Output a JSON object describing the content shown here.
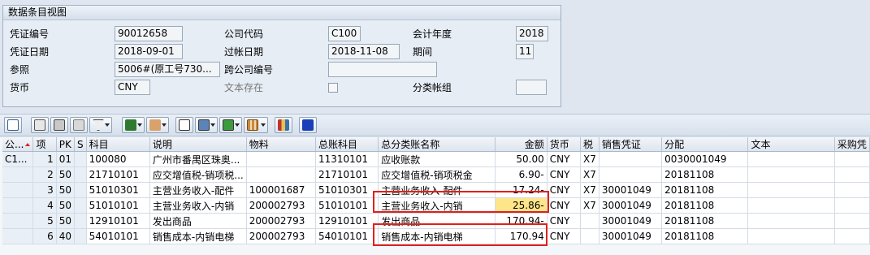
{
  "header": {
    "title": "数据条目视图",
    "doc_no_label": "凭证编号",
    "doc_no": "90012658",
    "company_label": "公司代码",
    "company": "C100",
    "fiscal_year_label": "会计年度",
    "fiscal_year": "2018",
    "doc_date_label": "凭证日期",
    "doc_date": "2018-09-01",
    "posting_date_label": "过帐日期",
    "posting_date": "2018-11-08",
    "period_label": "期间",
    "period": "11",
    "reference_label": "参照",
    "reference": "5006#(原工号730...",
    "cross_company_label": "跨公司编号",
    "cross_company": "",
    "currency_label": "货币",
    "currency": "CNY",
    "text_exists_label": "文本存在",
    "ledger_group_label": "分类帐组",
    "ledger_group": ""
  },
  "toolbar": {
    "buttons": [
      "details-icon",
      "print-icon",
      "filter-icon",
      "sort-icon",
      "filter-dropdown-icon",
      "sum-icon",
      "subtotal-icon",
      "print-preview-icon",
      "export-icon",
      "layout-icon",
      "grid-layout-icon",
      "abc-analysis-icon",
      "info-icon"
    ]
  },
  "table": {
    "columns": [
      "公...",
      "项",
      "PK",
      "S",
      "科目",
      "说明",
      "物料",
      "总账科目",
      "总分类账名称",
      "金额",
      "货币",
      "税",
      "销售凭证",
      "分配",
      "文本",
      "采购凭"
    ],
    "rows": [
      {
        "co": "C1...",
        "item": "1",
        "pk": "01",
        "s": "",
        "acct": "100080",
        "desc": "广州市番禺区珠奥...",
        "material": "",
        "gl": "11310101",
        "gl_name": "应收账款",
        "amount": "50.00",
        "curr": "CNY",
        "tax": "X7",
        "sales_doc": "",
        "assign": "0030001049",
        "text": "",
        "po": ""
      },
      {
        "co": "",
        "item": "2",
        "pk": "50",
        "s": "",
        "acct": "21710101",
        "desc": "应交增值税-销项税...",
        "material": "",
        "gl": "21710101",
        "gl_name": "应交增值税-销项税金",
        "amount": "6.90-",
        "curr": "CNY",
        "tax": "X7",
        "sales_doc": "",
        "assign": "20181108",
        "text": "",
        "po": ""
      },
      {
        "co": "",
        "item": "3",
        "pk": "50",
        "s": "",
        "acct": "51010301",
        "desc": "主营业务收入-配件",
        "material": "100001687",
        "gl": "51010301",
        "gl_name": "主营业务收入-配件",
        "amount": "17.24-",
        "curr": "CNY",
        "tax": "X7",
        "sales_doc": "30001049",
        "assign": "20181108",
        "text": "",
        "po": ""
      },
      {
        "co": "",
        "item": "4",
        "pk": "50",
        "s": "",
        "acct": "51010101",
        "desc": "主营业务收入-内销",
        "material": "200002793",
        "gl": "51010101",
        "gl_name": "主营业务收入-内销",
        "amount": "25.86-",
        "curr": "CNY",
        "tax": "X7",
        "sales_doc": "30001049",
        "assign": "20181108",
        "text": "",
        "po": ""
      },
      {
        "co": "",
        "item": "5",
        "pk": "50",
        "s": "",
        "acct": "12910101",
        "desc": "发出商品",
        "material": "200002793",
        "gl": "12910101",
        "gl_name": "发出商品",
        "amount": "170.94-",
        "curr": "CNY",
        "tax": "",
        "sales_doc": "30001049",
        "assign": "20181108",
        "text": "",
        "po": ""
      },
      {
        "co": "",
        "item": "6",
        "pk": "40",
        "s": "",
        "acct": "54010101",
        "desc": "销售成本-内销电梯",
        "material": "200002793",
        "gl": "54010101",
        "gl_name": "销售成本-内销电梯",
        "amount": "170.94",
        "curr": "CNY",
        "tax": "",
        "sales_doc": "30001049",
        "assign": "20181108",
        "text": "",
        "po": ""
      }
    ]
  },
  "colors": {
    "highlight": "#fde58a",
    "annotation": "#e0201b",
    "info": "#1a3fb8"
  }
}
